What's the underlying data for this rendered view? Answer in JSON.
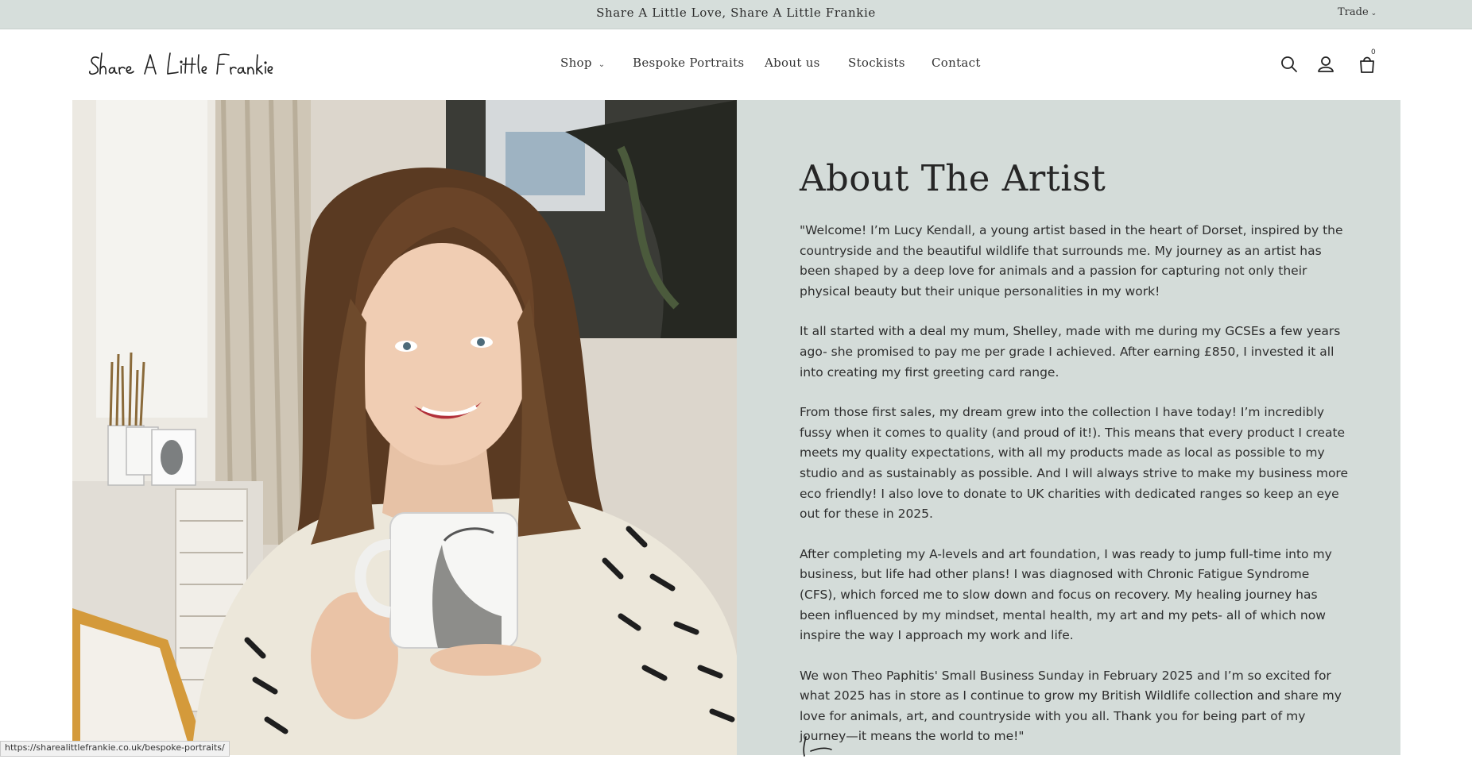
{
  "announcement": {
    "text": "Share A Little Love, Share A Little Frankie"
  },
  "trade": {
    "label": "Trade"
  },
  "logo": {
    "text": "Share A Little Frankie"
  },
  "nav": {
    "shop": "Shop",
    "bespoke": "Bespoke Portraits",
    "about": "About us",
    "stockists": "Stockists",
    "contact": "Contact"
  },
  "header_icons": {
    "search": "search-icon",
    "account": "account-icon",
    "cart": "cart-icon",
    "cart_count": "0"
  },
  "photo": {
    "alt": "Artist holding a highland cow mug"
  },
  "about": {
    "title": "About The Artist",
    "paragraphs": [
      "\"Welcome! I’m Lucy Kendall, a young artist based in the heart of Dorset, inspired by the countryside and the beautiful wildlife that surrounds me. My journey as an artist has been shaped by a deep love for animals and a passion for capturing not only their physical beauty but their unique personalities in my work!",
      "It all started with a deal my mum, Shelley, made with me during my GCSEs a few years ago- she promised to pay me per grade I achieved. After earning £850, I invested it all into creating my first greeting card range.",
      "From those first sales, my dream grew into the collection I have today! I’m incredibly fussy when it comes to quality (and proud of it!). This means that every product I create meets my quality expectations, with all my products made as local as possible to my studio and as sustainably as possible. And I will always strive to make my business more eco friendly! I also love to donate to UK charities with dedicated ranges so keep an eye out for these in 2025.",
      "After completing my A-levels and art foundation, I was ready to jump full-time into my business, but life had other plans! I was diagnosed with Chronic Fatigue Syndrome (CFS), which forced me to slow down and focus on recovery. My healing journey has been influenced by my mindset, mental health, my art and my pets- all of which now inspire the way I approach my work and life.",
      "We won Theo Paphitis' Small Business Sunday in February 2025 and I’m so excited for what 2025 has in store as I continue to grow my British Wildlife collection and share my love for animals, art, and countryside with you all. Thank you for being part of my journey—it means the world to me!\""
    ]
  },
  "status_bar": {
    "url": "https://sharealittlefrankie.co.uk/bespoke-portraits/"
  },
  "colors": {
    "announcement_bg": "#d6dedb",
    "panel_bg": "#d4dcd9",
    "text": "#2e2e2e"
  }
}
